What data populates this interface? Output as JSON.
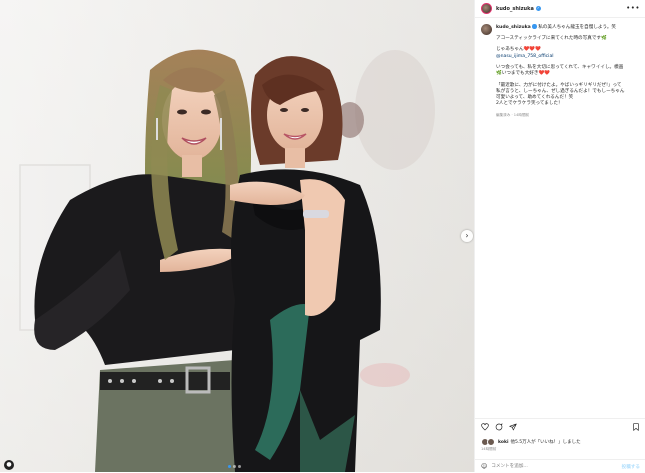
{
  "header": {
    "username": "kudo_shizuka",
    "more_icon": "more-horizontal-icon"
  },
  "caption": {
    "username": "kudo_shizuka",
    "lines": [
      "私の美人ちゃん龍玉を自慢しよう。笑",
      "",
      "アコースティックライブに来てくれた時の写真です🌿",
      "",
      "じゃあちゃん❤️❤️❤️",
      "@nasu_ijima_758_official",
      "",
      "いつ会っても、私を大切に思ってくれて、キャワイイし。模画",
      "🌿いつまでも大好き❤️❤️",
      "",
      "「最近歌に、力がに付けたよ。やばいっギリギリだぜ!」って",
      "私が言うと、しーちゃん、ぜし過ぎるんだよ！でもしーちゃん",
      "可愛いよって、助めてくれるんだ！笑",
      "2人とでケラケラ笑ってました！"
    ],
    "timestamp": "編集済み · 14時間前"
  },
  "actions": {
    "likes_user": "koki",
    "likes_text": "他5.5万人が「いいね！」しました",
    "post_date": "14時間前",
    "comment_placeholder": "コメントを追加...",
    "post_label": "投稿する"
  },
  "carousel": {
    "slide_count": 3,
    "active_index": 0
  }
}
